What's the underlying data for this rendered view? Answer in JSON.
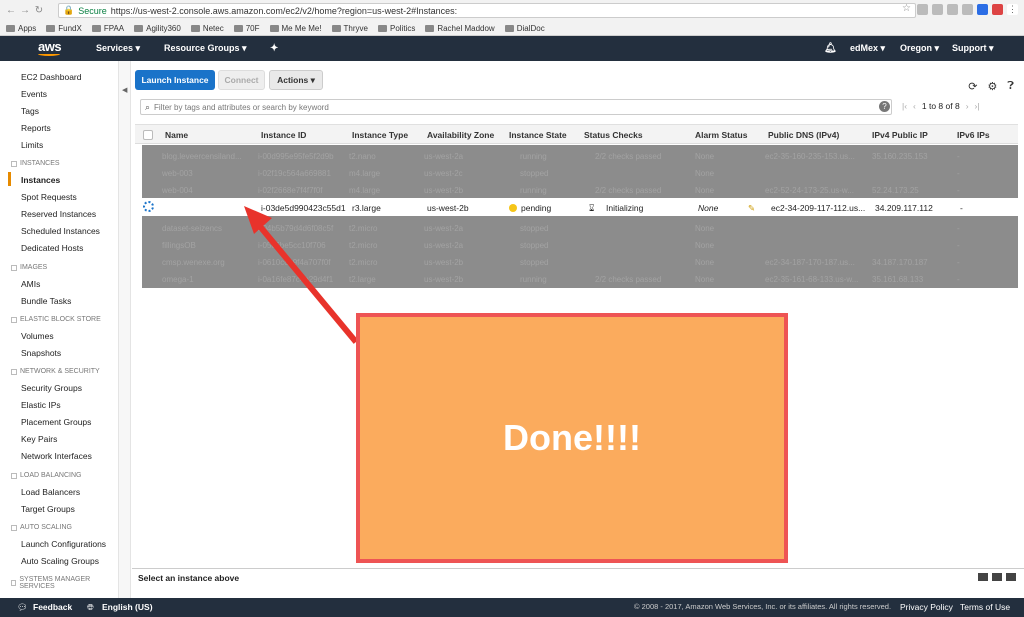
{
  "browser": {
    "secure_label": "Secure",
    "url": "https://us-west-2.console.aws.amazon.com/ec2/v2/home?region=us-west-2#Instances:",
    "bookmarks": [
      "Apps",
      "FundX",
      "FPAA",
      "Agility360",
      "Netec",
      "70F",
      "Me Me Me!",
      "Thryve",
      "Politics",
      "Rachel Maddow",
      "DialDoc"
    ]
  },
  "topnav": {
    "logo": "aws",
    "services": "Services ▾",
    "resource_groups": "Resource Groups ▾",
    "user": "edMex ▾",
    "region": "Oregon ▾",
    "support": "Support ▾"
  },
  "sidebar": {
    "items": [
      "EC2 Dashboard",
      "Events",
      "Tags",
      "Reports",
      "Limits"
    ],
    "instances_section": "INSTANCES",
    "instances_items": [
      "Instances",
      "Spot Requests",
      "Reserved Instances",
      "Scheduled Instances",
      "Dedicated Hosts"
    ],
    "images_section": "IMAGES",
    "images_items": [
      "AMIs",
      "Bundle Tasks"
    ],
    "ebs_section": "ELASTIC BLOCK STORE",
    "ebs_items": [
      "Volumes",
      "Snapshots"
    ],
    "net_section": "NETWORK & SECURITY",
    "net_items": [
      "Security Groups",
      "Elastic IPs",
      "Placement Groups",
      "Key Pairs",
      "Network Interfaces"
    ],
    "lb_section": "LOAD BALANCING",
    "lb_items": [
      "Load Balancers",
      "Target Groups"
    ],
    "as_section": "AUTO SCALING",
    "as_items": [
      "Launch Configurations",
      "Auto Scaling Groups"
    ],
    "sm_section": "SYSTEMS MANAGER SERVICES"
  },
  "toolbar": {
    "launch": "Launch Instance",
    "connect": "Connect",
    "actions": "Actions ▾"
  },
  "search": {
    "placeholder": "Filter by tags and attributes or search by keyword"
  },
  "pager": {
    "label": "1 to 8 of 8"
  },
  "columns": [
    "Name",
    "Instance ID",
    "Instance Type",
    "Availability Zone",
    "Instance State",
    "Status Checks",
    "Alarm Status",
    "Public DNS (IPv4)",
    "IPv4 Public IP",
    "IPv6 IPs"
  ],
  "rows": [
    {
      "name": "blog.leveercensiland...",
      "id": "i-00d995e95fe5f2d9b",
      "type": "t2.nano",
      "zone": "us-west-2a",
      "state": "running",
      "checks": "2/2 checks passed",
      "alarm": "None",
      "dns": "ec2-35-160-235-153.us...",
      "ip": "35.160.235.153",
      "ipv6": "-"
    },
    {
      "name": "web-003",
      "id": "i-02f19c564a669881",
      "type": "m4.large",
      "zone": "us-west-2c",
      "state": "stopped",
      "checks": "",
      "alarm": "None",
      "dns": "",
      "ip": "",
      "ipv6": "-"
    },
    {
      "name": "web-004",
      "id": "i-02f2668e7f4f7f0f",
      "type": "m4.large",
      "zone": "us-west-2b",
      "state": "running",
      "checks": "2/2 checks passed",
      "alarm": "None",
      "dns": "ec2-52-24-173-25.us-w...",
      "ip": "52.24.173.25",
      "ipv6": "-"
    },
    {
      "name": "",
      "id": "i-03de5d990423c55d1",
      "type": "r3.large",
      "zone": "us-west-2b",
      "state": "pending",
      "checks": "Initializing",
      "alarm": "None",
      "dns": "ec2-34-209-117-112.us...",
      "ip": "34.209.117.112",
      "ipv6": "-"
    },
    {
      "name": "dataset-seizencs",
      "id": "i-04b5b79d4d6f08c5f",
      "type": "t2.micro",
      "zone": "us-west-2a",
      "state": "stopped",
      "checks": "",
      "alarm": "None",
      "dns": "",
      "ip": "",
      "ipv6": "-"
    },
    {
      "name": "fillingsOB",
      "id": "i-05c6be5cc10f706",
      "type": "t2.micro",
      "zone": "us-west-2a",
      "state": "stopped",
      "checks": "",
      "alarm": "None",
      "dns": "",
      "ip": "",
      "ipv6": "-"
    },
    {
      "name": "cmsp.wenexe.org",
      "id": "i-0610cce9f4a707f0f",
      "type": "t2.micro",
      "zone": "us-west-2b",
      "state": "stopped",
      "checks": "",
      "alarm": "None",
      "dns": "ec2-34-187-170-187.us...",
      "ip": "34.187.170.187",
      "ipv6": "-"
    },
    {
      "name": "omega-1",
      "id": "i-0a16fe87c4e29d4f1",
      "type": "t2.large",
      "zone": "us-west-2b",
      "state": "running",
      "checks": "2/2 checks passed",
      "alarm": "None",
      "dns": "ec2-35-161-68-133.us-w...",
      "ip": "35.161.68.133",
      "ipv6": "-"
    }
  ],
  "detail": {
    "select_label": "Select an instance above"
  },
  "footer": {
    "feedback": "Feedback",
    "language": "English (US)",
    "copyright": "© 2008 - 2017, Amazon Web Services, Inc. or its affiliates. All rights reserved.",
    "privacy": "Privacy Policy",
    "terms": "Terms of Use"
  },
  "overlay": {
    "text": "Done!!!!"
  },
  "colors": {
    "nav": "#232f3e",
    "accent": "#1a73c9",
    "overlay_fill": "#fbab5d",
    "overlay_border": "#ee5454",
    "arrow": "#e8332b"
  }
}
